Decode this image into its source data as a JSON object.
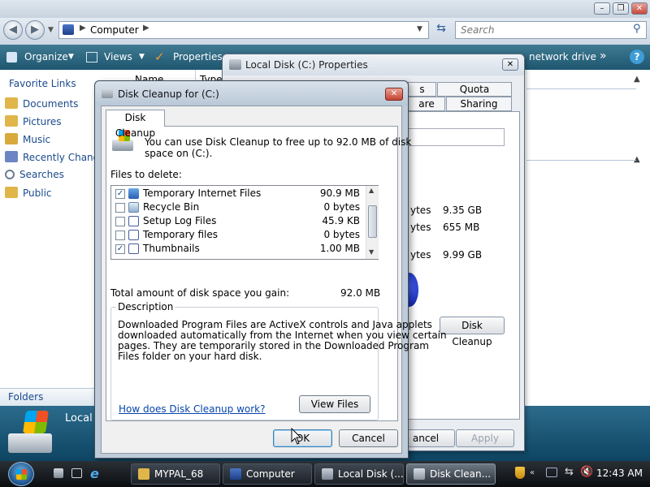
{
  "explorer": {
    "address": "Computer",
    "search_placeholder": "Search",
    "toolbar": {
      "organize": "Organize",
      "views": "Views",
      "properties": "Properties",
      "map_network_drive": "network drive",
      "overflow": "»"
    },
    "columns": {
      "name": "Name",
      "type": "Type"
    },
    "favorites_title": "Favorite Links",
    "favorites": [
      {
        "label": "Documents",
        "icon": "folder-icon"
      },
      {
        "label": "Pictures",
        "icon": "folder-icon"
      },
      {
        "label": "Music",
        "icon": "music-icon"
      },
      {
        "label": "Recently Changed",
        "icon": "recent-icon"
      },
      {
        "label": "Searches",
        "icon": "search-icon"
      },
      {
        "label": "Public",
        "icon": "folder-icon"
      }
    ],
    "folders_label": "Folders",
    "details_label": "Local"
  },
  "properties_dialog": {
    "title": "Local Disk (C:) Properties",
    "tabs_row1": [
      "s",
      "Quota"
    ],
    "tabs_row2": [
      "are",
      "Sharing"
    ],
    "stats": [
      {
        "unit": "ytes",
        "value": "9.35 GB"
      },
      {
        "unit": "ytes",
        "value": "655 MB"
      },
      {
        "unit": "ytes",
        "value": "9.99 GB"
      }
    ],
    "disk_cleanup_button": "Disk Cleanup",
    "cancel_button": "ancel",
    "apply_button": "Apply"
  },
  "disk_cleanup": {
    "title": "Disk Cleanup for  (C:)",
    "tab": "Disk Cleanup",
    "intro_line1": "You can use Disk Cleanup to free up to 92.0 MB of disk",
    "intro_line2": "space on  (C:).",
    "files_to_delete_label": "Files to delete:",
    "files": [
      {
        "checked": true,
        "name": "Temporary Internet Files",
        "size": "90.9 MB",
        "check_mark": "✓"
      },
      {
        "checked": false,
        "name": "Recycle Bin",
        "size": "0 bytes",
        "check_mark": ""
      },
      {
        "checked": false,
        "name": "Setup Log Files",
        "size": "45.9 KB",
        "check_mark": ""
      },
      {
        "checked": false,
        "name": "Temporary files",
        "size": "0 bytes",
        "check_mark": ""
      },
      {
        "checked": true,
        "name": "Thumbnails",
        "size": "1.00 MB",
        "check_mark": "✓"
      }
    ],
    "total_label": "Total amount of disk space you gain:",
    "total_value": "92.0 MB",
    "description_label": "Description",
    "description_lines": [
      "Downloaded Program Files are ActiveX controls and Java applets",
      "downloaded automatically from the Internet when you view certain",
      "pages. They are temporarily stored in the Downloaded Program",
      "Files folder on your hard disk."
    ],
    "view_files_button": "View Files",
    "help_link": "How does Disk Cleanup work?",
    "ok_button": "OK",
    "cancel_button": "Cancel"
  },
  "taskbar": {
    "tasks": [
      {
        "label": "MYPAL_68",
        "active": false
      },
      {
        "label": "Computer",
        "active": false
      },
      {
        "label": "Local Disk (...",
        "active": false
      },
      {
        "label": "Disk Clean...",
        "active": true
      }
    ],
    "clock": "12:43 AM"
  },
  "colors": {
    "link": "#1b4a8c",
    "toolbar": "#1e5670",
    "taskbar": "#0b0d10"
  }
}
